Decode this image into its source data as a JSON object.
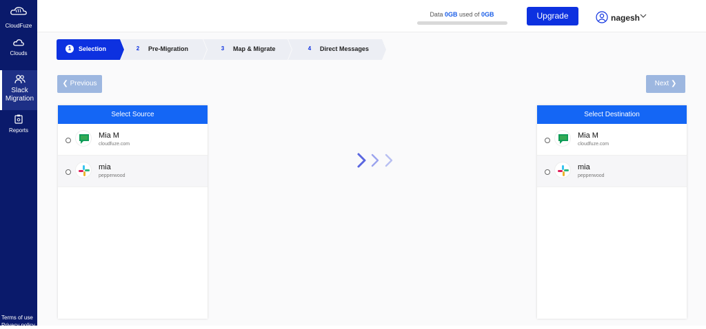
{
  "sidebar": {
    "brand": "CloudFuze",
    "items": [
      {
        "label": "Clouds",
        "icon": "cloud-icon"
      },
      {
        "label": "Slack Migration",
        "icon": "users-icon"
      },
      {
        "label": "Reports",
        "icon": "clipboard-icon"
      }
    ],
    "footer": {
      "terms": "Terms of use",
      "privacy": "Privacy policy"
    }
  },
  "topbar": {
    "data_prefix": "Data",
    "data_used": "0GB",
    "data_mid": "used of",
    "data_total": "0GB",
    "upgrade_label": "Upgrade",
    "username": "nagesh"
  },
  "steps": [
    {
      "num": "1",
      "label": "Selection",
      "active": true
    },
    {
      "num": "2",
      "label": "Pre-Migration"
    },
    {
      "num": "3",
      "label": "Map & Migrate"
    },
    {
      "num": "4",
      "label": "Direct Messages"
    }
  ],
  "buttons": {
    "previous": "Previous",
    "next": "Next"
  },
  "source": {
    "title": "Select Source",
    "accounts": [
      {
        "name": "Mia M",
        "domain": "cloudfuze.com",
        "icon": "google-chat-icon"
      },
      {
        "name": "mia",
        "domain": "pepperwood",
        "icon": "slack-icon"
      }
    ]
  },
  "destination": {
    "title": "Select Destination",
    "accounts": [
      {
        "name": "Mia M",
        "domain": "cloudfuze.com",
        "icon": "google-chat-icon"
      },
      {
        "name": "mia",
        "domain": "pepperwood",
        "icon": "slack-icon"
      }
    ]
  },
  "colors": {
    "sidebar": "#0a1a6b",
    "accent": "#0d31e0",
    "panel_head": "#1466f5",
    "disabled_button": "#9db7e0"
  }
}
